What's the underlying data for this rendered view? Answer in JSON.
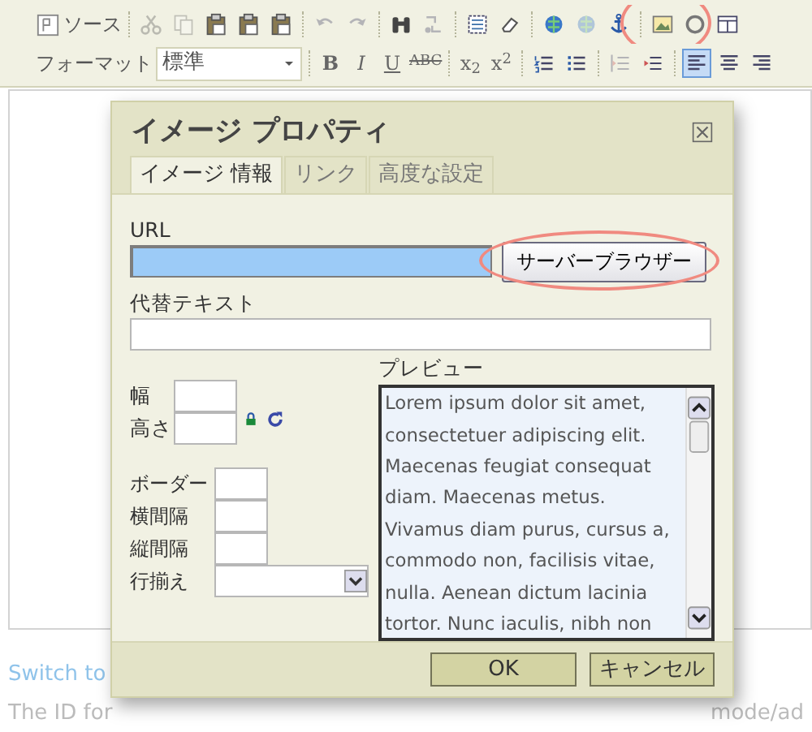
{
  "toolbar": {
    "rows": [
      [
        {
          "kind": "button",
          "label": "ソース"
        },
        {
          "kind": "sep"
        },
        {
          "kind": "icon",
          "disabled": true
        },
        {
          "kind": "icon",
          "disabled": true
        },
        {
          "kind": "icon",
          "disabled": false
        },
        {
          "kind": "icon",
          "disabled": false
        },
        {
          "kind": "icon",
          "disabled": false
        },
        {
          "kind": "sep"
        },
        {
          "kind": "icon",
          "disabled": true
        },
        {
          "kind": "icon",
          "disabled": true
        },
        {
          "kind": "sep"
        },
        {
          "kind": "icon",
          "disabled": false
        },
        {
          "kind": "icon",
          "disabled": true
        },
        {
          "kind": "sep"
        },
        {
          "kind": "icon",
          "disabled": false
        },
        {
          "kind": "icon",
          "disabled": false
        },
        {
          "kind": "sep"
        },
        {
          "kind": "icon",
          "disabled": false
        },
        {
          "kind": "icon",
          "disabled": true
        },
        {
          "kind": "icon",
          "disabled": false
        },
        {
          "kind": "sep"
        },
        {
          "kind": "icon",
          "disabled": false,
          "highlighted": true
        },
        {
          "kind": "icon",
          "disabled": false
        },
        {
          "kind": "icon",
          "disabled": false
        }
      ],
      [
        {
          "kind": "label",
          "label": "フォーマット"
        },
        {
          "kind": "select",
          "value": "標準"
        },
        {
          "kind": "sep"
        },
        {
          "kind": "text",
          "label": "B"
        },
        {
          "kind": "text",
          "label": "I"
        },
        {
          "kind": "text",
          "label": "U"
        },
        {
          "kind": "text",
          "label": "ABC"
        },
        {
          "kind": "sep"
        },
        {
          "kind": "text",
          "label": "x$_{2}$"
        },
        {
          "kind": "text",
          "label": "x$^{2}$"
        },
        {
          "kind": "sep"
        },
        {
          "kind": "icon",
          "disabled": false
        },
        {
          "kind": "icon",
          "disabled": false
        },
        {
          "kind": "sep"
        },
        {
          "kind": "icon",
          "disabled": true
        },
        {
          "kind": "icon",
          "disabled": false
        },
        {
          "kind": "sep"
        },
        {
          "kind": "icon",
          "disabled": false,
          "selected": true
        },
        {
          "kind": "icon",
          "disabled": false,
          "selected": false
        },
        {
          "kind": "icon",
          "disabled": false,
          "selected": false
        }
      ]
    ]
  },
  "below_editor": {
    "link": "Switch to",
    "note_start": "The ID for",
    "note_end": "mode/ad"
  },
  "dialog": {
    "title": "イメージ プロパティ",
    "tabs": [
      {
        "label": "イメージ 情報",
        "selected": true
      },
      {
        "label": "リンク",
        "selected": false
      },
      {
        "label": "高度な設定",
        "selected": false
      }
    ],
    "url": {
      "label": "URL",
      "focused": true
    },
    "browse_button": {
      "label": "サーバーブラウザー",
      "highlighted": true
    },
    "alt_text": {
      "label": "代替テキスト"
    },
    "size_fields": [
      {
        "label": "幅"
      },
      {
        "label": "高さ"
      }
    ],
    "spacing_fields": [
      {
        "label": "ボーダー"
      },
      {
        "label": "横間隔"
      },
      {
        "label": "縦間隔"
      }
    ],
    "align_field": {
      "label": "行揃え"
    },
    "preview": {
      "label": "プレビュー",
      "lines": [
        "Lorem ipsum dolor sit amet,",
        "consectetuer adipiscing elit.",
        "Maecenas feugiat consequat",
        "diam. Maecenas metus.",
        "Vivamus diam purus, cursus a,",
        "commodo non, facilisis vitae,",
        "nulla. Aenean dictum lacinia",
        "tortor. Nunc iaculis, nibh non"
      ]
    },
    "buttons": [
      {
        "label": "OK"
      },
      {
        "label": "キャンセル"
      }
    ]
  }
}
